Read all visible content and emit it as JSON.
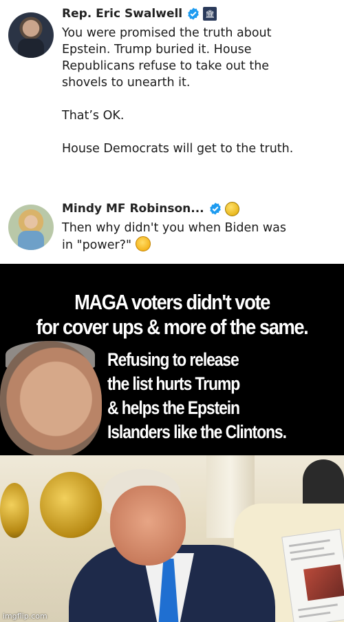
{
  "tweets": [
    {
      "author": "Rep. Eric Swalwell",
      "badges": [
        "verified-icon",
        "government-building-icon"
      ],
      "lines": [
        "You were promised the truth about",
        "Epstein. Trump buried it. House",
        "Republicans refuse to take out the",
        "shovels to unearth it."
      ],
      "line2": "That’s OK.",
      "line3": "House Democrats will get to the truth."
    },
    {
      "author": "Mindy MF Robinson...",
      "badges": [
        "verified-icon",
        "gold-coin-icon"
      ],
      "lines": [
        "Then why didn't you when Biden was",
        "in \"power?\""
      ],
      "emoji": "face-with-monocle-icon"
    }
  ],
  "meme": {
    "headline_1": "MAGA voters didn't vote",
    "headline_2": "for cover ups & more of the same.",
    "sub_1": "Refusing to release",
    "sub_2": "the list hurts Trump",
    "sub_3": "& helps the Epstein",
    "sub_4": "Islanders like the Clintons."
  },
  "watermark": "imgflip.com",
  "colors": {
    "verified": "#1d9bf0",
    "panel_bg": "#000000",
    "panel_text": "#ffffff",
    "tie": "#1f6fd1"
  }
}
